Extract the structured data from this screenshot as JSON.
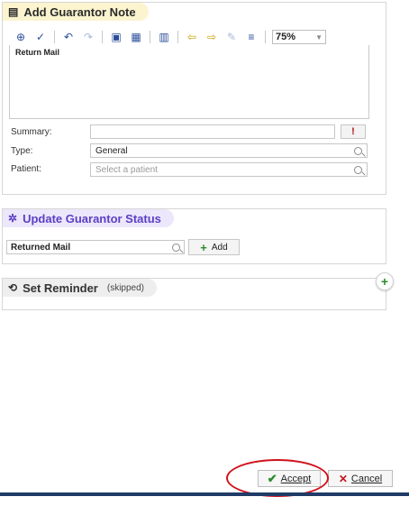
{
  "note_section": {
    "title": "Add Guarantor Note",
    "icon": "note-icon",
    "zoom": "75%",
    "note_text": "Return Mail",
    "summary_label": "Summary:",
    "summary_value": "",
    "type_label": "Type:",
    "type_value": "General",
    "patient_label": "Patient:",
    "patient_placeholder": "Select a patient",
    "flag_glyph": "!"
  },
  "status_section": {
    "title": "Update Guarantor Status",
    "icon": "asterisk-icon",
    "status_value": "Returned Mail",
    "add_label": "Add"
  },
  "reminder_section": {
    "title": "Set Reminder",
    "state": "(skipped)",
    "icon": "reminder-icon"
  },
  "footer": {
    "accept_label": "Accept",
    "cancel_label": "Cancel"
  },
  "colors": {
    "note_header": "#fbf4cf",
    "status_header": "#ece7fa",
    "status_title": "#5b3fc4",
    "annotation": "#d0121b",
    "bottom_bar": "#1f3b66"
  }
}
